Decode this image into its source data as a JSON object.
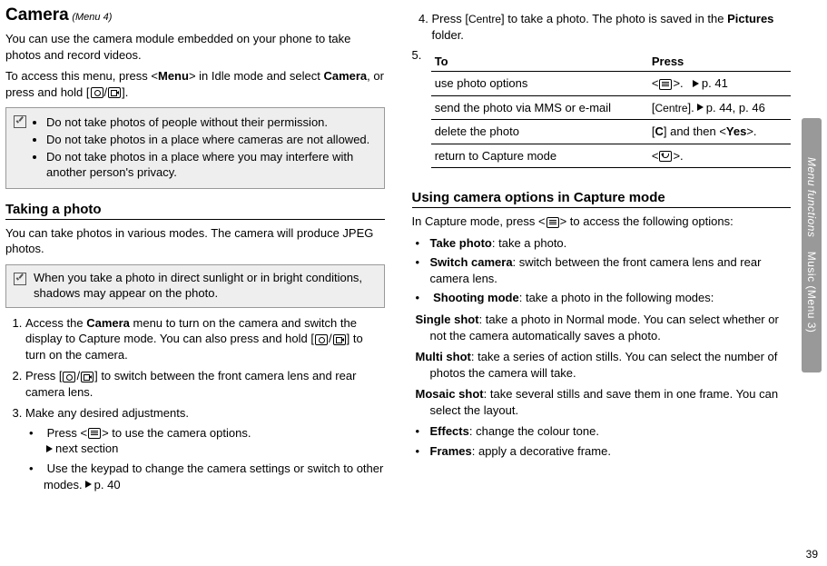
{
  "left": {
    "title": "Camera",
    "menu_tag": "(Menu 4)",
    "intro1": "You can use the camera module embedded on your phone to take photos and record videos.",
    "intro2_a": "To access this menu, press <",
    "intro2_b": "Menu",
    "intro2_c": "> in Idle mode and select ",
    "intro2_d": "Camera",
    "intro2_e": ", or press and hold [",
    "intro2_f": "].",
    "note1": {
      "items": [
        "Do not take photos of people without their permission.",
        "Do not take photos in a place where cameras are not allowed.",
        "Do not take photos in a place where you may interfere with another person's privacy."
      ]
    },
    "h2": "Taking a photo",
    "after_h2": "You can take photos in various modes. The camera will produce JPEG photos.",
    "note2": "When you take a photo in direct sunlight or in bright conditions, shadows may appear on the photo.",
    "steps": {
      "s1_a": "Access the ",
      "s1_b": "Camera",
      "s1_c": " menu to turn on the camera and switch the display to Capture mode. You can also press and hold [",
      "s1_d": "] to turn on the camera.",
      "s2_a": "Press [",
      "s2_b": "] to switch between the front camera lens and rear camera lens.",
      "s3": "Make any desired adjustments.",
      "s3_b1_a": "Press <",
      "s3_b1_b": "> to use the camera options.",
      "s3_b1_c": "next section",
      "s3_b2_a": "Use the keypad to change the camera settings or switch to other modes.",
      "s3_b2_b": "p. 40"
    }
  },
  "right": {
    "s4_a": "Press [",
    "s4_key": "Centre",
    "s4_b": "] to take a photo. The photo is saved in the ",
    "s4_c": "Pictures",
    "s4_d": " folder.",
    "table": {
      "h1": "To",
      "h2": "Press",
      "rows": [
        {
          "to": "use photo options",
          "press_a": "<",
          "press_b": ">.",
          "press_c": "p. 41",
          "icon": "menu"
        },
        {
          "to": "send the photo via MMS or e-mail",
          "press_a": " [",
          "press_key": "Centre",
          "press_b": "].",
          "press_c": "p. 44, p. 46"
        },
        {
          "to": "delete the photo",
          "press_a": "[",
          "press_key": "C",
          "press_b": "] and then <",
          "press_key2": "Yes",
          "press_c": ">."
        },
        {
          "to": "return to Capture mode",
          "press_a": "<",
          "press_b": ">.",
          "icon": "back"
        }
      ]
    },
    "h2": "Using camera options in Capture mode",
    "p_a": "In Capture mode, press <",
    "p_b": "> to access the following options:",
    "opts": {
      "o1_b": "Take photo",
      "o1_t": ": take a photo.",
      "o2_b": "Switch camera",
      "o2_t": ": switch between the front camera lens and rear camera lens.",
      "o3_b": "Shooting mode",
      "o3_t": ": take a photo in the following modes:",
      "o3_1b": "Single shot",
      "o3_1t": ": take a photo in Normal mode. You can select whether or not the camera automatically saves a photo.",
      "o3_2b": "Multi shot",
      "o3_2t": ": take a series of action stills. You can select the number of photos the camera will take.",
      "o3_3b": "Mosaic shot",
      "o3_3t": ": take several stills and save them in one frame. You can select the layout.",
      "o4_b": "Effects",
      "o4_t": ": change the colour tone.",
      "o5_b": "Frames",
      "o5_t": ": apply a decorative frame."
    }
  },
  "side": {
    "a": "Menu functions",
    "b": "Music (Menu 3)"
  },
  "page_num": "39",
  "step5_num": "5."
}
